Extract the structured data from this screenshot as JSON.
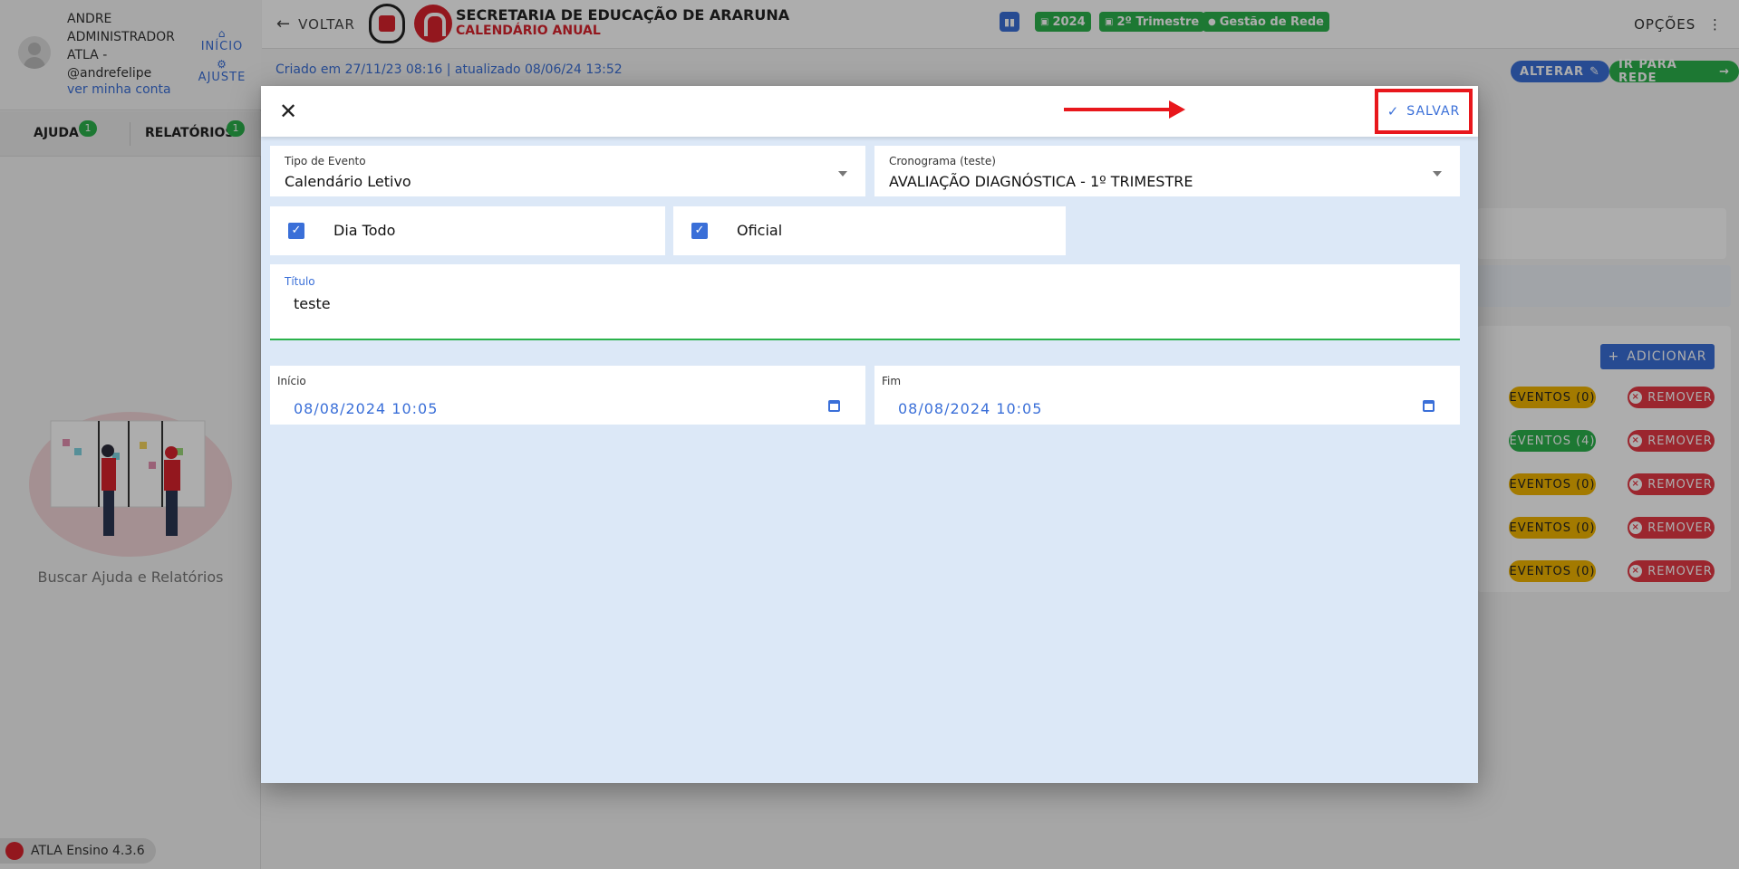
{
  "sidebar": {
    "user_name": "ANDRE ADMINISTRADOR ATLA - @andrefelipe",
    "account_link": "ver minha conta",
    "home_label": "INÍCIO",
    "settings_label": "AJUSTE",
    "tabs": [
      {
        "label": "AJUDA",
        "badge": "1"
      },
      {
        "label": "RELATÓRIOS",
        "badge": "1"
      }
    ],
    "help_text": "Buscar Ajuda e Relatórios",
    "version": "ATLA Ensino 4.3.6"
  },
  "topbar": {
    "back_label": "VOLTAR",
    "org_name": "SECRETARIA DE EDUCAÇÃO DE ARARUNA",
    "page_title": "CALENDÁRIO ANUAL",
    "chips": [
      "2024",
      "2º Trimestre",
      "Gestão de Rede"
    ],
    "options_label": "OPÇÕES"
  },
  "background": {
    "meta": "Criado em 27/11/23 08:16 | atualizado 08/06/24 13:52",
    "alter_label": "ALTERAR",
    "network_label": "IR PARA REDE",
    "add_label": "ADICIONAR",
    "rows": [
      {
        "events": "EVENTOS (0)",
        "remove": "REMOVER"
      },
      {
        "events": "EVENTOS (4)",
        "remove": "REMOVER"
      },
      {
        "events": "EVENTOS (0)",
        "remove": "REMOVER"
      },
      {
        "events": "EVENTOS (0)",
        "remove": "REMOVER"
      },
      {
        "events": "EVENTOS (0)",
        "remove": "REMOVER"
      }
    ]
  },
  "modal": {
    "save_label": "SALVAR",
    "event_type": {
      "label": "Tipo de Evento",
      "value": "Calendário Letivo"
    },
    "schedule": {
      "label": "Cronograma (teste)",
      "value": "AVALIAÇÃO DIAGNÓSTICA - 1º TRIMESTRE"
    },
    "all_day": {
      "label": "Dia Todo",
      "checked": true
    },
    "official": {
      "label": "Oficial",
      "checked": true
    },
    "title": {
      "label": "Título",
      "value": "teste"
    },
    "start": {
      "label": "Início",
      "value": "08/08/2024 10:05"
    },
    "end": {
      "label": "Fim",
      "value": "08/08/2024 10:05"
    }
  },
  "colors": {
    "primary": "#3a6fd8",
    "success": "#2bb24c",
    "warning": "#f0b400",
    "danger": "#e53945",
    "brand_red": "#d9232d",
    "highlight": "#e8171c"
  },
  "icons": [
    "arrow-left-icon",
    "home-icon",
    "gear-icon",
    "chart-icon",
    "calendar-icon",
    "check-circle-icon",
    "dots-vertical-icon",
    "close-icon",
    "check-icon",
    "chevron-down-icon",
    "calendar-icon",
    "pencil-icon",
    "arrow-right-icon",
    "plus-icon",
    "x-circle-icon"
  ]
}
